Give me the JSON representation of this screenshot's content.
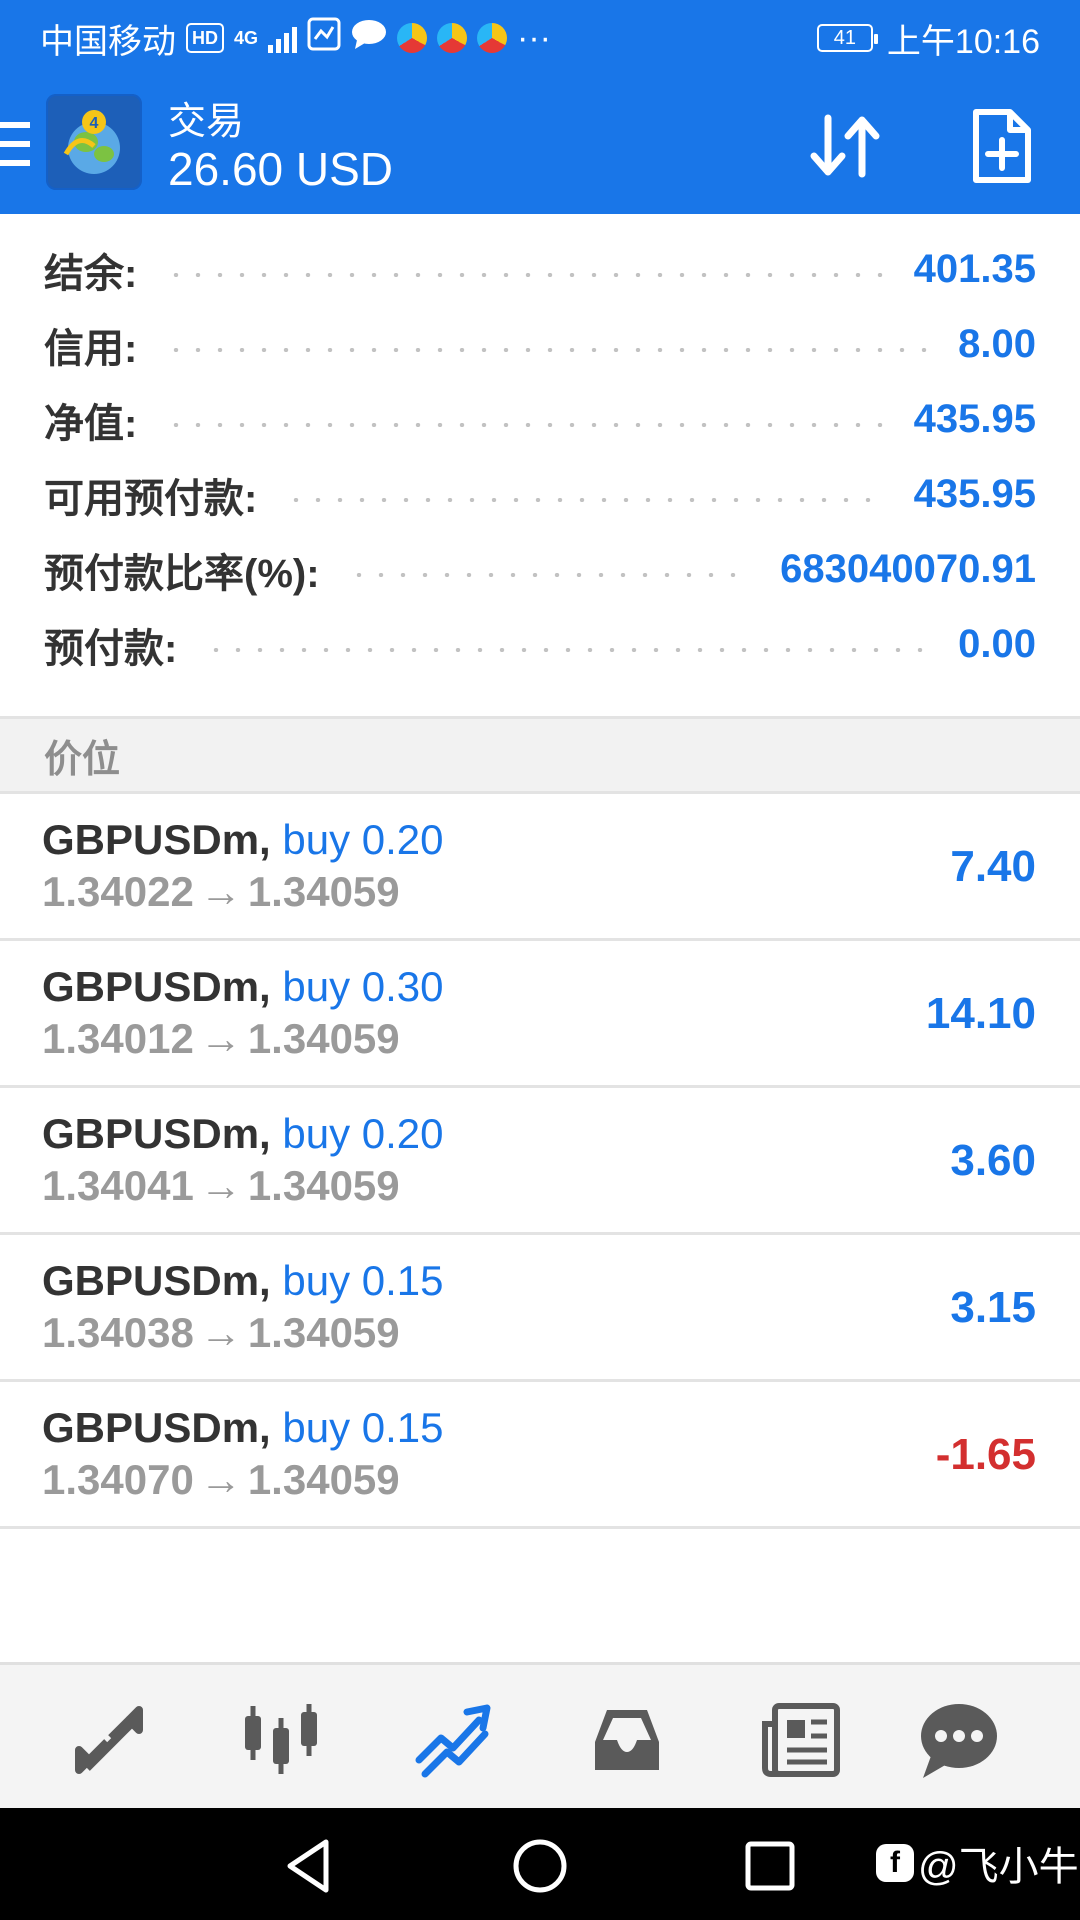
{
  "status_bar": {
    "carrier": "中国移动",
    "hd_badge": "HD",
    "network_badge": "4G",
    "battery_level": "41",
    "time": "上午10:16",
    "more": "···"
  },
  "header": {
    "title": "交易",
    "balance": "26.60 USD"
  },
  "summary": [
    {
      "label": "结余:",
      "value": "401.35"
    },
    {
      "label": "信用:",
      "value": "8.00"
    },
    {
      "label": "净值:",
      "value": "435.95"
    },
    {
      "label": "可用预付款:",
      "value": "435.95"
    },
    {
      "label": "预付款比率(%):",
      "value": "683040070.91"
    },
    {
      "label": "预付款:",
      "value": "0.00"
    }
  ],
  "section_title": "价位",
  "arrow_glyph": "→",
  "positions": [
    {
      "symbol": "GBPUSDm,",
      "side": "buy 0.20",
      "open": "1.34022",
      "current": "1.34059",
      "profit": "7.40",
      "negative": false
    },
    {
      "symbol": "GBPUSDm,",
      "side": "buy 0.30",
      "open": "1.34012",
      "current": "1.34059",
      "profit": "14.10",
      "negative": false
    },
    {
      "symbol": "GBPUSDm,",
      "side": "buy 0.20",
      "open": "1.34041",
      "current": "1.34059",
      "profit": "3.60",
      "negative": false
    },
    {
      "symbol": "GBPUSDm,",
      "side": "buy 0.15",
      "open": "1.34038",
      "current": "1.34059",
      "profit": "3.15",
      "negative": false
    },
    {
      "symbol": "GBPUSDm,",
      "side": "buy 0.15",
      "open": "1.34070",
      "current": "1.34059",
      "profit": "-1.65",
      "negative": true
    }
  ],
  "bottom_nav": {
    "items": [
      "quotes-icon",
      "chart-icon",
      "trade-icon",
      "history-icon",
      "news-icon",
      "chat-icon"
    ],
    "active": "trade-icon"
  },
  "watermark": {
    "logo": "f",
    "text": "@飞小牛"
  },
  "colors": {
    "primary": "#1976e8",
    "negative": "#d32f2f",
    "muted": "#9a9a9a",
    "nav_icon": "#5a5a5a"
  }
}
